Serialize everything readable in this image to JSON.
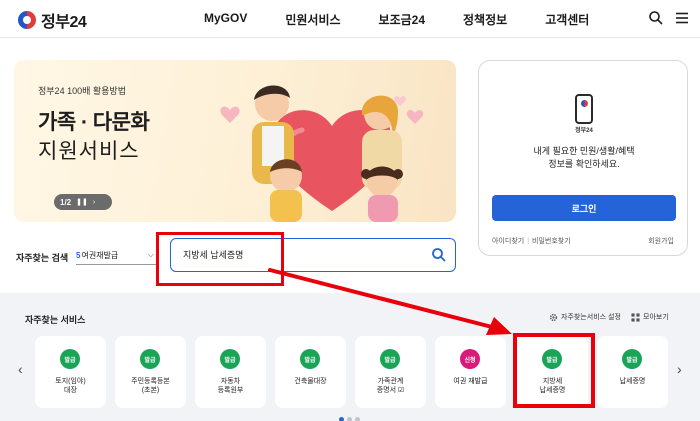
{
  "header": {
    "logo_text": "정부24",
    "nav": [
      "MyGOV",
      "민원서비스",
      "보조금24",
      "정책정보",
      "고객센터"
    ]
  },
  "banner": {
    "kicker": "정부24 100배 활용방법",
    "title_line1": "가족 · 다문화",
    "title_line2": "지원서비스",
    "pager": "1/2",
    "pause_glyph": "❚❚",
    "next_glyph": "›"
  },
  "login": {
    "phone_label": "정부24",
    "message_line1": "내게 필요한 민원/생활/혜택",
    "message_line2": "정보를 확인하세요.",
    "button": "로그인",
    "find_id": "아이디찾기",
    "find_pw": "비밀번호찾기",
    "signup": "회원가입"
  },
  "search": {
    "label": "자주찾는 검색",
    "select_num": "5",
    "select_text": "여권재발급",
    "input_value": "지방세 납세증명"
  },
  "services": {
    "title": "자주찾는 서비스",
    "setting": "자주찾는서비스 설정",
    "view_all": "모아보기",
    "cards": [
      {
        "badge": "발급",
        "line1": "토지(임야)",
        "line2": "대장"
      },
      {
        "badge": "발급",
        "line1": "주민등록등본",
        "line2": "(초본)"
      },
      {
        "badge": "발급",
        "line1": "자동차",
        "line2": "등록원부"
      },
      {
        "badge": "발급",
        "line1": "건축물대장",
        "line2": ""
      },
      {
        "badge": "발급",
        "line1": "가족관계",
        "line2": "증명서 ☑"
      },
      {
        "badge": "신청",
        "line1": "여권 재발급",
        "line2": ""
      },
      {
        "badge": "발급",
        "line1": "지방세",
        "line2": "납세증명"
      },
      {
        "badge": "발급",
        "line1": "납세증명",
        "line2": ""
      }
    ]
  },
  "colors": {
    "accent": "#2563d9",
    "badge_green": "#1aa457",
    "badge_pink": "#d81b7a",
    "annotation_red": "#e8000b"
  }
}
